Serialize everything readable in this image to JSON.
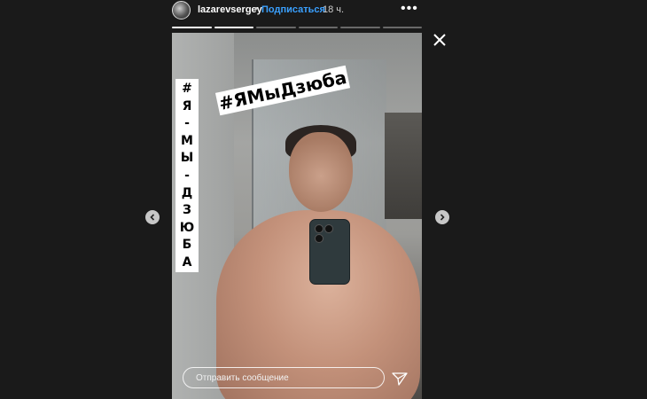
{
  "header": {
    "username": "lazarevsergey",
    "separator": "•",
    "follow_label": "Подписаться",
    "time": "18 ч.",
    "more": "•••"
  },
  "progress": {
    "segments_total": 6,
    "segments_done": 2
  },
  "story": {
    "sticker_hashtag": "#ЯМыДзюба",
    "sticker_vertical": [
      "#",
      "Я",
      "-",
      "М",
      "Ы",
      "-",
      "Д",
      "З",
      "Ю",
      "Б",
      "А"
    ]
  },
  "reply": {
    "placeholder": "Отправить сообщение"
  },
  "icons": {
    "close": "close-icon",
    "send": "send-icon",
    "prev": "chevron-left-icon",
    "next": "chevron-right-icon",
    "more": "more-icon"
  },
  "colors": {
    "background": "#1a1a1a",
    "follow": "#3aa0ff",
    "nav": "#c7c7c7"
  }
}
